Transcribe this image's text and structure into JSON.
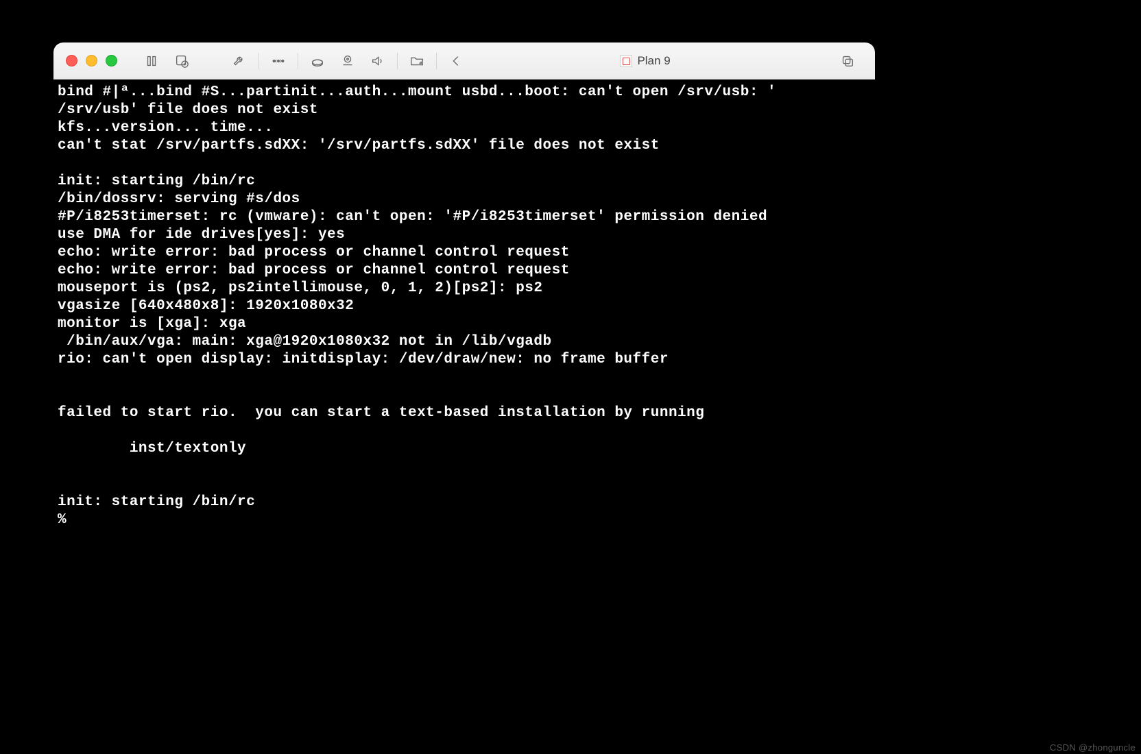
{
  "window": {
    "title": "Plan 9"
  },
  "terminal": {
    "lines": [
      "bind #|ª...bind #S...partinit...auth...mount usbd...boot: can't open /srv/usb: '",
      "/srv/usb' file does not exist",
      "kfs...version... time...",
      "can't stat /srv/partfs.sdXX: '/srv/partfs.sdXX' file does not exist",
      "",
      "init: starting /bin/rc",
      "/bin/dossrv: serving #s/dos",
      "#P/i8253timerset: rc (vmware): can't open: '#P/i8253timerset' permission denied",
      "use DMA for ide drives[yes]: yes",
      "echo: write error: bad process or channel control request",
      "echo: write error: bad process or channel control request",
      "mouseport is (ps2, ps2intellimouse, 0, 1, 2)[ps2]: ps2",
      "vgasize [640x480x8]: 1920x1080x32",
      "monitor is [xga]: xga",
      " /bin/aux/vga: main: xga@1920x1080x32 not in /lib/vgadb",
      "rio: can't open display: initdisplay: /dev/draw/new: no frame buffer",
      "",
      "",
      "failed to start rio.  you can start a text-based installation by running",
      "",
      "        inst/textonly",
      "",
      "",
      "init: starting /bin/rc",
      "% "
    ]
  },
  "watermark": "CSDN @zhonguncle"
}
